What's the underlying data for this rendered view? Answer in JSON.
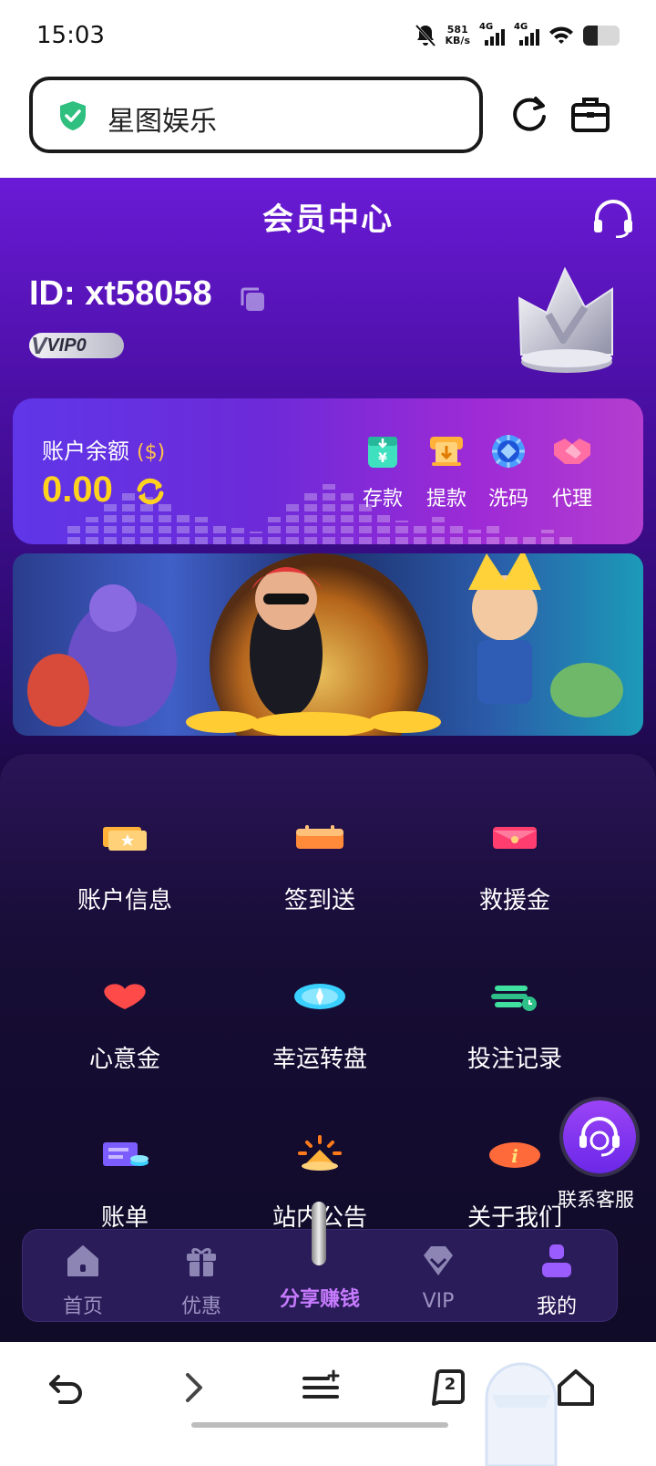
{
  "status_bar": {
    "time": "15:03",
    "net_speed_value": "581",
    "net_speed_unit": "KB/s",
    "signal1": "4G",
    "signal2": "4G",
    "battery_level": 0.4
  },
  "browser": {
    "site_title": "星图娱乐",
    "tab_count": "2"
  },
  "app": {
    "title": "会员中心",
    "user_id": "ID: xt58058",
    "vip_level": "VIP0",
    "balance": {
      "label": "账户余额",
      "currency": "($)",
      "value": "0.00"
    },
    "actions": [
      {
        "label": "存款",
        "icon": "deposit-icon"
      },
      {
        "label": "提款",
        "icon": "withdraw-icon"
      },
      {
        "label": "洗码",
        "icon": "rebate-chip-icon"
      },
      {
        "label": "代理",
        "icon": "agent-handshake-icon"
      }
    ],
    "menu": [
      {
        "label": "账户信息",
        "icon": "account-card-icon"
      },
      {
        "label": "签到送",
        "icon": "calendar-icon"
      },
      {
        "label": "救援金",
        "icon": "red-envelope-icon"
      },
      {
        "label": "心意金",
        "icon": "heart-icon"
      },
      {
        "label": "幸运转盘",
        "icon": "wheel-icon"
      },
      {
        "label": "投注记录",
        "icon": "bet-record-icon"
      },
      {
        "label": "账单",
        "icon": "bill-icon"
      },
      {
        "label": "站内公告",
        "icon": "announcement-icon"
      },
      {
        "label": "关于我们",
        "icon": "info-icon"
      }
    ],
    "support_label": "联系客服",
    "nav": [
      {
        "label": "首页",
        "icon": "home-icon"
      },
      {
        "label": "优惠",
        "icon": "gift-icon"
      },
      {
        "label": "分享赚钱",
        "icon": "share-icon"
      },
      {
        "label": "VIP",
        "icon": "diamond-icon"
      },
      {
        "label": "我的",
        "icon": "profile-icon"
      }
    ]
  },
  "colors": {
    "brand_purple": "#6a1bd6",
    "balance_yellow": "#ffd21f",
    "share_accent": "#c77bff"
  }
}
